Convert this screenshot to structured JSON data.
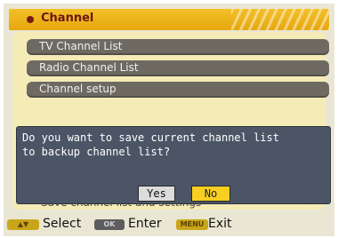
{
  "header": {
    "title": "Channel"
  },
  "menu": {
    "items": [
      {
        "label": "TV Channel List"
      },
      {
        "label": "Radio Channel List"
      },
      {
        "label": "Channel setup"
      }
    ],
    "hidden_item": {
      "label": "Save channel list and settings"
    }
  },
  "dialog": {
    "message": "Do you want to save current channel list\nto backup channel list?",
    "yes_label": "Yes",
    "no_label": "No",
    "focused": "No"
  },
  "footer": {
    "select": {
      "key": "▲▼",
      "label": "Select"
    },
    "enter": {
      "key": "OK",
      "label": "Enter"
    },
    "exit": {
      "key": "MENU",
      "label": "Exit"
    }
  },
  "colors": {
    "header": "#e7a70e",
    "panel": "#f5ebb6",
    "item": "#6e6a62",
    "dialog": "#4b5566",
    "focus": "#f7cf20"
  }
}
